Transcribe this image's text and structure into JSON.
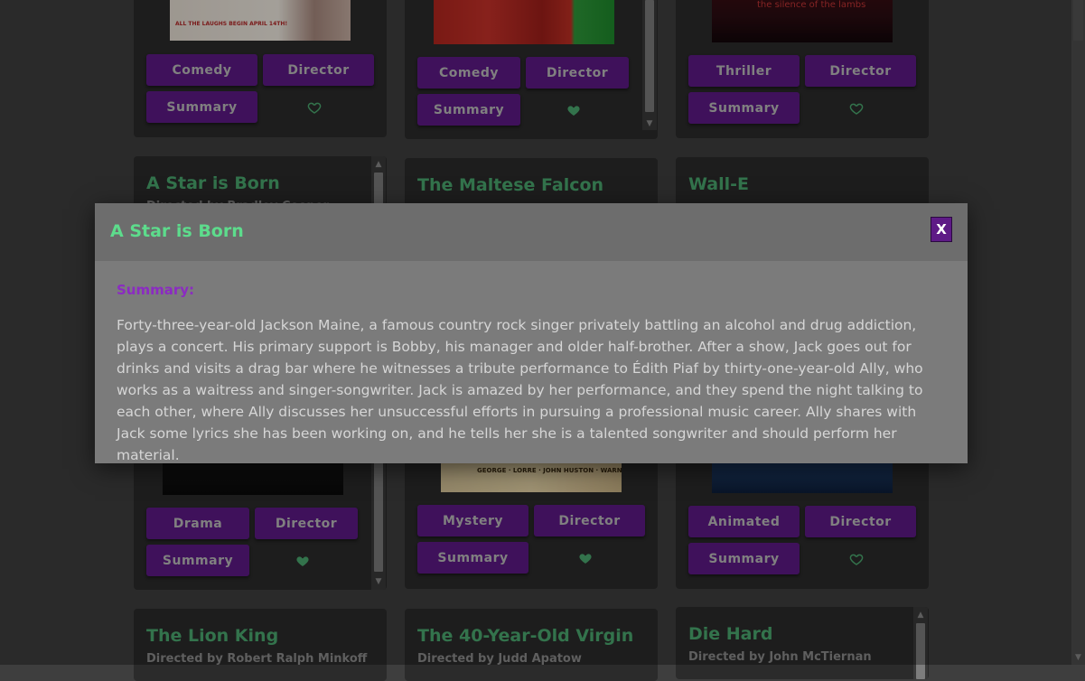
{
  "colors": {
    "accent_green": "#4caa70",
    "button_purple": "#5e1a86",
    "card_bg": "#2b2b2b",
    "modal_title_green": "#5ddc8c",
    "summary_label_purple": "#8b2bc2"
  },
  "top_row": [
    {
      "genre": "Comedy",
      "director": "Director",
      "summary": "Summary",
      "favorited": false
    },
    {
      "genre": "Comedy",
      "director": "Director",
      "summary": "Summary",
      "favorited": true
    },
    {
      "genre": "Thriller",
      "director": "Director",
      "summary": "Summary",
      "favorited": false
    }
  ],
  "poster_texts": {
    "poster_1_tagline": "ALL THE LAUGHS BEGIN APRIL 14TH!",
    "poster_3_title": "the silence of the lambs",
    "poster_falcon_credits": "GEORGE · LORRE · JOHN HUSTON · WARNER BROS."
  },
  "middle_row": [
    {
      "title": "A Star is Born",
      "subtitle": "Directed by Bradley Cooper",
      "genre": "Drama",
      "director": "Director",
      "summary": "Summary",
      "favorited": true
    },
    {
      "title": "The Maltese Falcon",
      "genre": "Mystery",
      "director": "Director",
      "summary": "Summary",
      "favorited": true
    },
    {
      "title": "Wall-E",
      "genre": "Animated",
      "director": "Director",
      "summary": "Summary",
      "favorited": false
    }
  ],
  "bottom_row": [
    {
      "title": "The Lion King",
      "subtitle": "Directed by Robert Ralph Minkoff"
    },
    {
      "title": "The 40-Year-Old Virgin",
      "subtitle": "Directed by Judd Apatow"
    },
    {
      "title": "Die Hard",
      "subtitle": "Directed by John McTiernan"
    }
  ],
  "modal": {
    "title": "A Star is Born",
    "close_label": "X",
    "summary_label": "Summary:",
    "summary_text": "Forty-three-year-old Jackson Maine, a famous country rock singer privately battling an alcohol and drug addiction, plays a concert. His primary support is Bobby, his manager and older half-brother. After a show, Jack goes out for drinks and visits a drag bar where he witnesses a tribute performance to Édith Piaf by thirty-one-year-old Ally, who works as a waitress and singer-songwriter. Jack is amazed by her performance, and they spend the night talking to each other, where Ally discusses her unsuccessful efforts in pursuing a professional music career. Ally shares with Jack some lyrics she has been working on, and he tells her she is a talented songwriter and should perform her material."
  },
  "icons": {
    "favorite": "heart-icon",
    "scroll_up": "arrow-up-icon",
    "scroll_down": "arrow-down-icon"
  }
}
